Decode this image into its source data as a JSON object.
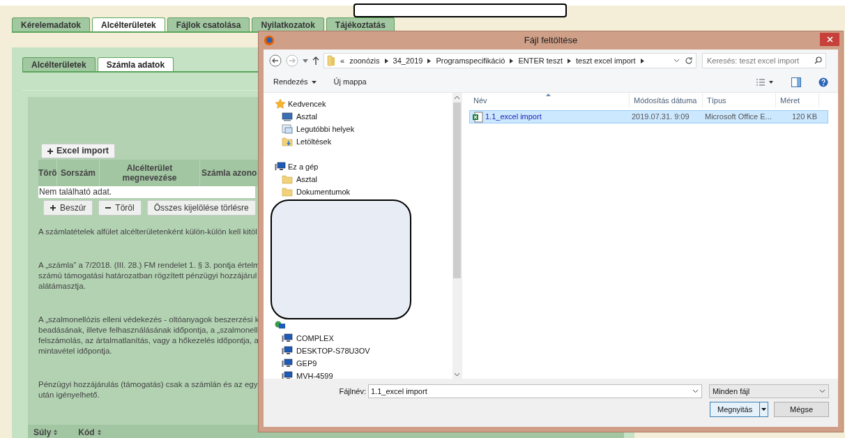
{
  "top_tabs": [
    {
      "label": "Kérelemadatok",
      "selected": false
    },
    {
      "label": "Alcélterületek",
      "selected": true
    },
    {
      "label": "Fájlok csatolása",
      "selected": false
    },
    {
      "label": "Nyilatkozatok",
      "selected": false
    },
    {
      "label": "Tájékoztatás",
      "selected": false
    }
  ],
  "sub_tabs": [
    {
      "label": "Alcélterületek",
      "selected": false
    },
    {
      "label": "Számla adatok",
      "selected": true
    }
  ],
  "excel_button": "Excel import",
  "table": {
    "columns": [
      "Törö",
      "Sorszám",
      "Alcélterület megnevezése",
      "Számla azono"
    ],
    "empty_text": "Nem található adat."
  },
  "table_buttons": [
    {
      "label": "Beszúr",
      "kind": "add"
    },
    {
      "label": "Töröl",
      "kind": "remove"
    },
    {
      "label": "Összes kijelölése törlésre",
      "kind": "plain"
    }
  ],
  "paragraphs": [
    [
      "A számlatételek alfület alcélterületenként külön-külön kell kitöl"
    ],
    [
      "A „számla” a 7/2018. (III. 28.) FM rendelet 1. § 3. pontja értelm",
      "számú támogatási határozatban rögzített pénzügyi hozzájárul",
      "alátámasztja."
    ],
    [
      "A „szalmonellózis elleni védekezés - oltóanyagok beszerzési k",
      "beadásának, illetve felhasználásának időpontja, a „szalmonell",
      "felszámolás, az ártalmatlanítás, vagy a hőkezelés időpontja, a",
      "mintavétel időpontja."
    ],
    [
      "Pénzügyi hozzájárulás (támogatás) csak a számlán és az egy",
      "után igényelhető."
    ]
  ],
  "bottom_columns": [
    "Súly",
    "Kód"
  ],
  "dialog": {
    "title": "Fájl feltöltése",
    "path_prefix": "«",
    "path": [
      "zoonózis",
      "34_2019",
      "Programspecifikáció",
      "ENTER teszt",
      "teszt excel import"
    ],
    "search": {
      "placeholder": "Keresés: teszt excel import"
    },
    "toolbar": [
      {
        "label": "Rendezés",
        "kind": "menu"
      },
      {
        "label": "Új mappa",
        "kind": "plain"
      }
    ],
    "nav": [
      {
        "label": "Kedvencek",
        "kind": "star",
        "children": [
          {
            "label": "Asztal",
            "kind": "desktop"
          },
          {
            "label": "Legutóbbi helyek",
            "kind": "recent"
          },
          {
            "label": "Letöltések",
            "kind": "downloads"
          }
        ]
      },
      {
        "label": "Ez a gép",
        "kind": "pc",
        "children": [
          {
            "label": "Asztal",
            "kind": "folder"
          },
          {
            "label": "Dokumentumok",
            "kind": "folder"
          }
        ]
      },
      {
        "kind": "network",
        "children": [
          {
            "label": "COMPLEX",
            "kind": "pc"
          },
          {
            "label": "DESKTOP-S78U3OV",
            "kind": "pc"
          },
          {
            "label": "GEP9",
            "kind": "pc"
          },
          {
            "label": "MVH-4599",
            "kind": "pc"
          }
        ]
      }
    ],
    "columns": [
      "Név",
      "Módosítás dátuma",
      "Típus",
      "Méret"
    ],
    "files": [
      {
        "name": "1.1_excel import",
        "date": "2019.07.31. 9:09",
        "type": "Microsoft Office E...",
        "size": "120 KB",
        "selected": true
      }
    ],
    "filename_label": "Fájlnév:",
    "filename": "1.1_excel import",
    "filter": "Minden fájl",
    "buttons": [
      {
        "label": "Megnyitás",
        "kind": "split"
      },
      {
        "label": "Mégse",
        "kind": "plain"
      }
    ]
  }
}
